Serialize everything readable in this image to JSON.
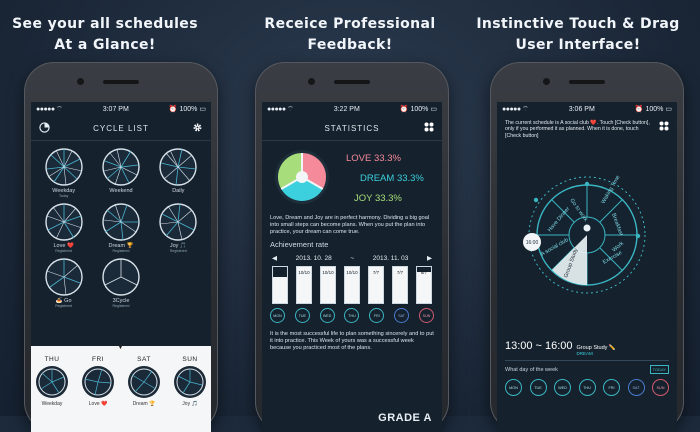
{
  "headlines": [
    [
      "See your all schedules",
      "At a Glance!"
    ],
    [
      "Receice Professional",
      "Feedback!"
    ],
    [
      "Instinctive Touch & Drag",
      "User Interface!"
    ]
  ],
  "phone1": {
    "status": {
      "carrier": "●●●●● ",
      "time": "3:07 PM",
      "battery": "100%"
    },
    "title": "CYCLE LIST",
    "cycles": [
      {
        "label": "Weekday",
        "sub": "Today"
      },
      {
        "label": "Weekend",
        "sub": ""
      },
      {
        "label": "Daily",
        "sub": ""
      },
      {
        "label": "Love ❤️",
        "sub": "Registered"
      },
      {
        "label": "Dream 🏆",
        "sub": "Registered"
      },
      {
        "label": "Joy 🎵",
        "sub": "Registered"
      },
      {
        "label": "🍝 Go",
        "sub": "Registered"
      },
      {
        "label": "3Cycle",
        "sub": "Registered"
      }
    ],
    "caret": "▼",
    "days": [
      {
        "name": "THU",
        "label": "Weekday"
      },
      {
        "name": "FRI",
        "label": "Love ❤️"
      },
      {
        "name": "SAT",
        "label": "Dream 🏆"
      },
      {
        "name": "SUN",
        "label": "Joy 🎵"
      }
    ]
  },
  "phone2": {
    "status": {
      "carrier": "●●●●● ",
      "time": "3:22 PM",
      "battery": "100%"
    },
    "title": "STATISTICS",
    "love": "LOVE 33.3%",
    "dream": "DREAM 33.3%",
    "joy": "JOY 33.3%",
    "summary": "Love, Dream and Joy are in perfect harmony. Dividing a big goal into small steps can become plans. When you put the plan into practice, your dream can come true.",
    "achievement": "Achievement rate",
    "range_start": "2013. 10. 28",
    "range_sep": "~",
    "range_end": "2013. 11. 03",
    "prev": "◀",
    "next": "▶",
    "bars": [
      {
        "frac": "8/11",
        "rate": 0.73
      },
      {
        "frac": "10/10",
        "rate": 1.0
      },
      {
        "frac": "10/10",
        "rate": 1.0
      },
      {
        "frac": "10/10",
        "rate": 1.0
      },
      {
        "frac": "7/7",
        "rate": 1.0
      },
      {
        "frac": "7/7",
        "rate": 1.0
      },
      {
        "frac": "6/7",
        "rate": 0.86
      }
    ],
    "weekdays": [
      "MON",
      "TUE",
      "WED",
      "THU",
      "FRI",
      "SAT",
      "SUN"
    ],
    "feedback": "It is the most successful life to plan something sincerely and to put it into practice. This Week of yours was a successful week  because you practiced most of the plans.",
    "grade": "GRADE A"
  },
  "phone3": {
    "status": {
      "carrier": "●●●●● ",
      "time": "3:06 PM",
      "battery": "100%"
    },
    "note": "The current schedule is A social club ❤️. Touch [Check button], only if you performed it as planned. When it is done, touch [Check button]",
    "segments": [
      "Waking Time",
      "Go to work",
      "Breakfast",
      "Have Dinner",
      "A social club",
      "Group Study",
      "Exercise",
      "Work"
    ],
    "handle_label": "16:00",
    "time_start": "13:00",
    "time_sep": "~",
    "time_end": "16:00",
    "activity": "Group Study ✏️",
    "activity_sub": "DREAM",
    "question": "What day of the week",
    "today": "TODAY",
    "weekdays": [
      "MON",
      "TUE",
      "WED",
      "THU",
      "FRI",
      "SAT",
      "SUN"
    ]
  },
  "colors": {
    "love": "#f48a9a",
    "dream": "#3cd0de",
    "joy": "#a7dd7a",
    "accent": "#3ab6c2"
  }
}
